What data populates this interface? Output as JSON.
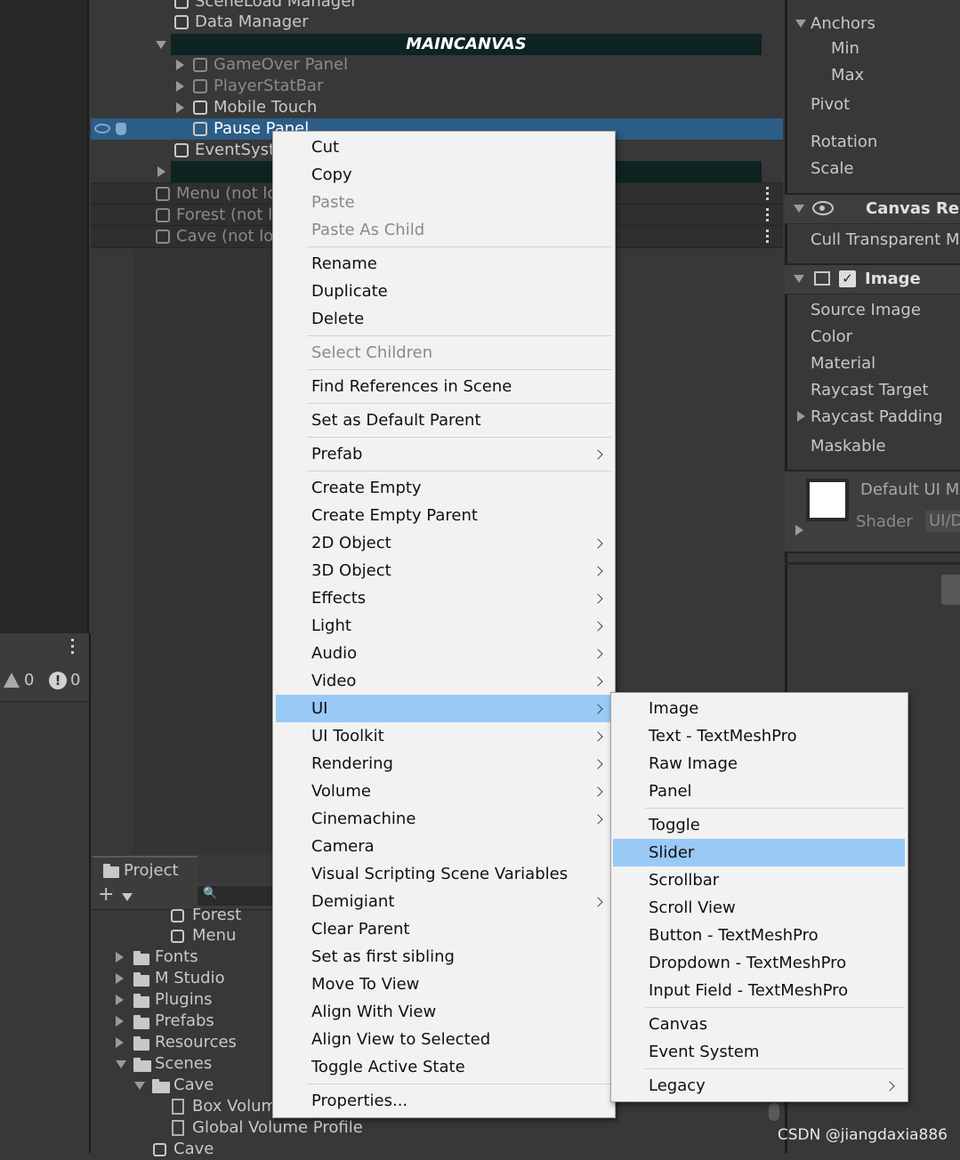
{
  "hierarchy": {
    "rows": [
      {
        "label": "SceneLoad Manager",
        "dim": false
      },
      {
        "label": "Data Manager",
        "dim": false
      },
      {
        "label": "MAINCANVAS",
        "dim": false
      },
      {
        "label": "GameOver Panel",
        "dim": true
      },
      {
        "label": "PlayerStatBar",
        "dim": true
      },
      {
        "label": "Mobile Touch",
        "dim": false
      },
      {
        "label": "Pause Panel",
        "dim": false
      },
      {
        "label": "EventSyst",
        "dim": false
      }
    ],
    "scenes": [
      {
        "label": "Menu (not lo"
      },
      {
        "label": "Forest (not lo"
      },
      {
        "label": "Cave (not lo"
      }
    ]
  },
  "console": {
    "warnings": "0",
    "errors": "0"
  },
  "inspector": {
    "anchors": "Anchors",
    "min": "Min",
    "max": "Max",
    "pivot": "Pivot",
    "rotation": "Rotation",
    "scale": "Scale",
    "canvas_renderer": "Canvas Ren",
    "cull_transparent": "Cull Transparent M",
    "image": "Image",
    "source_image": "Source Image",
    "color": "Color",
    "material": "Material",
    "raycast_target": "Raycast Target",
    "raycast_padding": "Raycast Padding",
    "maskable": "Maskable",
    "default_ui": "Default UI M",
    "shader": "Shader",
    "shader_value": "UI/D"
  },
  "project": {
    "tab": "Project",
    "items": [
      {
        "label": "Forest",
        "type": "scene"
      },
      {
        "label": "Menu",
        "type": "scene"
      },
      {
        "label": "Fonts",
        "type": "folder"
      },
      {
        "label": "M Studio",
        "type": "folder"
      },
      {
        "label": "Plugins",
        "type": "folder"
      },
      {
        "label": "Prefabs",
        "type": "folder"
      },
      {
        "label": "Resources",
        "type": "folder"
      },
      {
        "label": "Scenes",
        "type": "folder-open"
      },
      {
        "label": "Cave",
        "type": "folder-open"
      },
      {
        "label": "Box Volum",
        "type": "asset"
      },
      {
        "label": "Global Volume Profile",
        "type": "asset"
      },
      {
        "label": "Cave",
        "type": "scene"
      }
    ]
  },
  "context_menu": {
    "items": [
      {
        "label": "Cut"
      },
      {
        "label": "Copy"
      },
      {
        "label": "Paste",
        "disabled": true
      },
      {
        "label": "Paste As Child",
        "disabled": true
      },
      {
        "label": "Rename"
      },
      {
        "label": "Duplicate"
      },
      {
        "label": "Delete"
      },
      {
        "label": "Select Children",
        "disabled": true
      },
      {
        "label": "Find References in Scene"
      },
      {
        "label": "Set as Default Parent"
      },
      {
        "label": "Prefab",
        "submenu": true
      },
      {
        "label": "Create Empty"
      },
      {
        "label": "Create Empty Parent"
      },
      {
        "label": "2D Object",
        "submenu": true
      },
      {
        "label": "3D Object",
        "submenu": true
      },
      {
        "label": "Effects",
        "submenu": true
      },
      {
        "label": "Light",
        "submenu": true
      },
      {
        "label": "Audio",
        "submenu": true
      },
      {
        "label": "Video",
        "submenu": true
      },
      {
        "label": "UI",
        "submenu": true,
        "highlighted": true
      },
      {
        "label": "UI Toolkit",
        "submenu": true
      },
      {
        "label": "Rendering",
        "submenu": true
      },
      {
        "label": "Volume",
        "submenu": true
      },
      {
        "label": "Cinemachine",
        "submenu": true
      },
      {
        "label": "Camera"
      },
      {
        "label": "Visual Scripting Scene Variables"
      },
      {
        "label": "Demigiant",
        "submenu": true
      },
      {
        "label": "Clear Parent"
      },
      {
        "label": "Set as first sibling"
      },
      {
        "label": "Move To View"
      },
      {
        "label": "Align With View"
      },
      {
        "label": "Align View to Selected"
      },
      {
        "label": "Toggle Active State"
      },
      {
        "label": "Properties..."
      }
    ]
  },
  "ui_submenu": {
    "items": [
      {
        "label": "Image"
      },
      {
        "label": "Text - TextMeshPro"
      },
      {
        "label": "Raw Image"
      },
      {
        "label": "Panel"
      },
      {
        "label": "Toggle"
      },
      {
        "label": "Slider",
        "highlighted": true
      },
      {
        "label": "Scrollbar"
      },
      {
        "label": "Scroll View"
      },
      {
        "label": "Button - TextMeshPro"
      },
      {
        "label": "Dropdown - TextMeshPro"
      },
      {
        "label": "Input Field - TextMeshPro"
      },
      {
        "label": "Canvas"
      },
      {
        "label": "Event System"
      },
      {
        "label": "Legacy",
        "submenu": true
      }
    ]
  },
  "watermark": "CSDN @jiangdaxia886",
  "colors": {
    "highlight": "#99c9f5",
    "selection": "#2c5d87",
    "menu_bg": "#f2f2f2"
  }
}
